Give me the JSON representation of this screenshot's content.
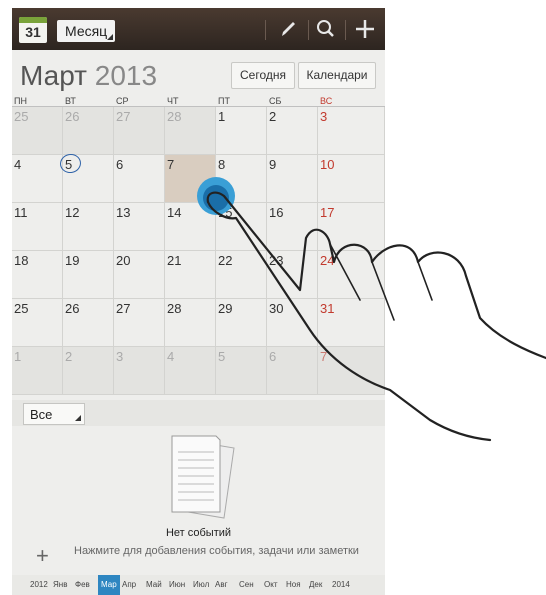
{
  "actionbar": {
    "calendar_icon_day": "31",
    "view_spinner": "Месяц",
    "icons": [
      "pencil-icon",
      "search-icon",
      "plus-icon"
    ]
  },
  "header": {
    "month": "Март",
    "year": "2013",
    "today_button": "Сегодня",
    "calendars_button": "Календари"
  },
  "weekdays": [
    "ПН",
    "ВТ",
    "СР",
    "ЧТ",
    "ПТ",
    "СБ",
    "ВС"
  ],
  "weeks": [
    [
      "25",
      "26",
      "27",
      "28",
      "1",
      "2",
      "3"
    ],
    [
      "4",
      "5",
      "6",
      "7",
      "8",
      "9",
      "10"
    ],
    [
      "11",
      "12",
      "13",
      "14",
      "15",
      "16",
      "17"
    ],
    [
      "18",
      "19",
      "20",
      "21",
      "22",
      "23",
      "24"
    ],
    [
      "25",
      "26",
      "27",
      "28",
      "29",
      "30",
      "31"
    ],
    [
      "1",
      "2",
      "3",
      "4",
      "5",
      "6",
      "7"
    ]
  ],
  "filter": {
    "label": "Все"
  },
  "empty_state": {
    "title": "Нет событий",
    "hint": "Нажмите для добавления события, задачи или заметки"
  },
  "month_bar": [
    "2012",
    "Янв",
    "Фев",
    "Мар",
    "Апр",
    "Май",
    "Июн",
    "Июл",
    "Авг",
    "Сен",
    "Окт",
    "Ноя",
    "Дек",
    "2014"
  ],
  "colors": {
    "sunday": "#c23a2e",
    "accent": "#2e86c1",
    "actionbar": "#3a2f28"
  }
}
